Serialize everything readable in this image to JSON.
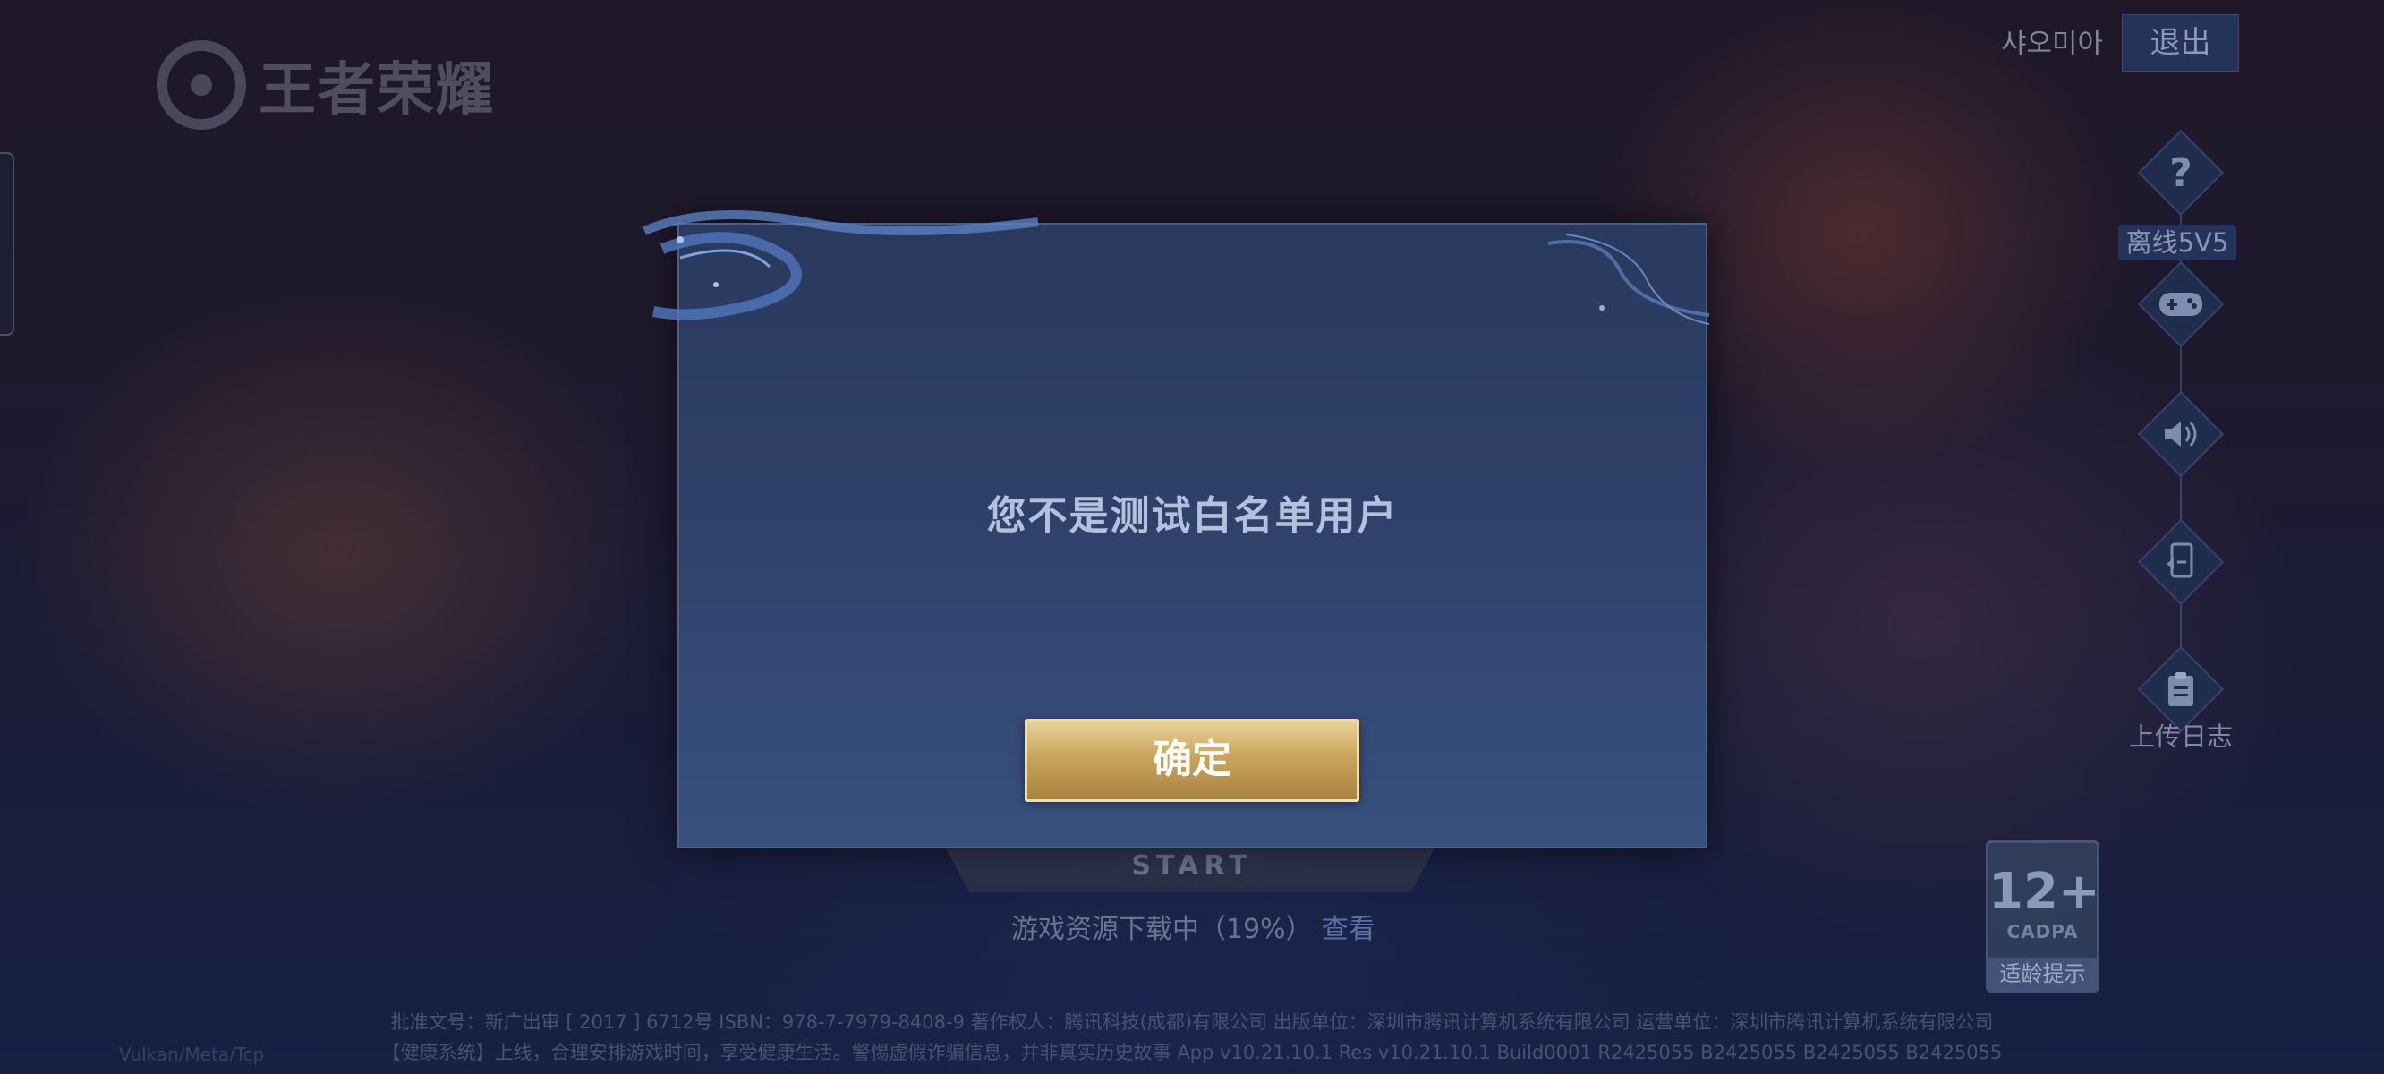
{
  "app": {
    "logo_text": "王者荣耀",
    "user_name": "샤오미아",
    "exit_label": "退出"
  },
  "side_menu": {
    "help_icon": "question-icon",
    "offline_label": "离线5V5",
    "gamepad_icon": "gamepad-icon",
    "sound_icon": "speaker-icon",
    "switch_icon": "phone-switch-icon",
    "upload_icon": "clipboard-icon",
    "upload_label": "上传日志"
  },
  "start": {
    "label": "START"
  },
  "download": {
    "status": "游戏资源下载中（19%）",
    "progress_percent": 19,
    "view_link": "查看"
  },
  "rating": {
    "age": "12+",
    "org": "CADPA",
    "tip": "适龄提示"
  },
  "footer": {
    "line1": "批准文号：新广出审 [ 2017 ] 6712号  ISBN：978-7-7979-8408-9  著作权人：腾讯科技(成都)有限公司  出版单位：深圳市腾讯计算机系统有限公司  运营单位：深圳市腾讯计算机系统有限公司",
    "line2": "【健康系统】上线，合理安排游戏时间，享受健康生活。警惕虚假诈骗信息，并非真实历史故事 App v10.21.10.1 Res v10.21.10.1 Build0001 R2425055 B2425055 B2425055 B2425055",
    "version": "Vulkan/Meta/Tcp"
  },
  "dialog": {
    "message": "您不是测试白名单用户",
    "confirm_label": "确定"
  }
}
